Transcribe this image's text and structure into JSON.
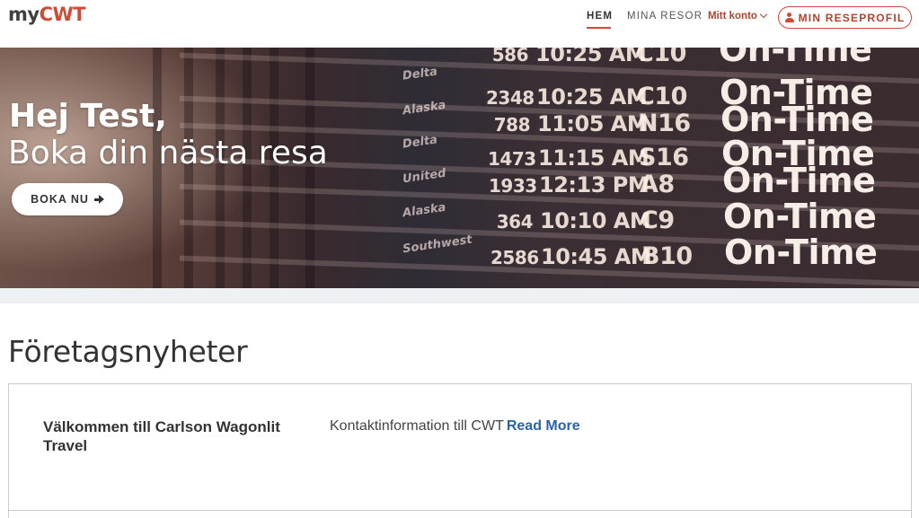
{
  "header": {
    "logo_prefix": "my",
    "logo_brand": "CWT",
    "nav": {
      "home": "HEM",
      "trips": "MINA RESOR",
      "account": "Mitt konto"
    },
    "profile_button": "MIN RESEPROFIL",
    "icons": {
      "profile": "user-icon",
      "account": "chevron-down-icon"
    },
    "accent_color": "#d04a35"
  },
  "hero": {
    "greeting": "Hej  Test,",
    "subtitle": "Boka din nästa resa",
    "book_button": "BOKA NU",
    "book_icon": "arrow-right-icon",
    "board": {
      "airlines": [
        "Delta",
        "Alaska",
        "Delta",
        "United",
        "Alaska",
        "Southwest"
      ],
      "rows": [
        {
          "flight": "586",
          "time": "10:25 AM",
          "gate": "C10",
          "status": "On-Time"
        },
        {
          "flight": "2348",
          "time": "10:25 AM",
          "gate": "C10",
          "status": "On-Time"
        },
        {
          "flight": "788",
          "time": "11:05 AM",
          "gate": "N16",
          "status": "On-Time"
        },
        {
          "flight": "1473",
          "time": "11:15 AM",
          "gate": "S16",
          "status": "On-Time"
        },
        {
          "flight": "1933",
          "time": "12:13 PM",
          "gate": "A8",
          "status": "On-Time"
        },
        {
          "flight": "364",
          "time": "10:10 AM",
          "gate": "C9",
          "status": "On-Time"
        },
        {
          "flight": "2586",
          "time": "10:45 AM",
          "gate": "B10",
          "status": "On-Time"
        }
      ]
    }
  },
  "news": {
    "title": "Företagsnyheter",
    "items": [
      {
        "headline": "Välkommen till Carlson Wagonlit Travel",
        "body": "Kontaktinformation till CWT",
        "link": "Read More"
      }
    ],
    "link_color": "#2a64a8"
  }
}
